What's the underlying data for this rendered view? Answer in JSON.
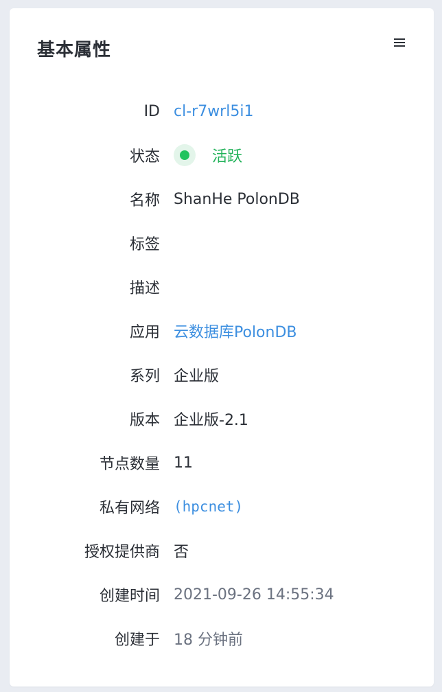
{
  "card": {
    "title": "基本属性",
    "menu_icon": "hamburger-menu-icon"
  },
  "properties": {
    "id": {
      "label": "ID",
      "value": "cl-r7wrl5i1"
    },
    "status": {
      "label": "状态",
      "value": "活跃",
      "color": "#21c35e"
    },
    "name": {
      "label": "名称",
      "value": "ShanHe PolonDB"
    },
    "tags": {
      "label": "标签",
      "value": ""
    },
    "description": {
      "label": "描述",
      "value": ""
    },
    "app": {
      "label": "应用",
      "value": "云数据库PolonDB"
    },
    "series": {
      "label": "系列",
      "value": "企业版"
    },
    "version": {
      "label": "版本",
      "value": "企业版-2.1"
    },
    "node_count": {
      "label": "节点数量",
      "value": "11"
    },
    "vpc": {
      "label": "私有网络",
      "value": "(hpcnet)"
    },
    "auth_provider": {
      "label": "授权提供商",
      "value": "否"
    },
    "create_time": {
      "label": "创建时间",
      "value": "2021-09-26 14:55:34"
    },
    "created_ago": {
      "label": "创建于",
      "value": "18 分钟前"
    }
  },
  "colors": {
    "link": "#3d8fe0",
    "status_green": "#21c35e",
    "text": "#2b2f36",
    "muted": "#6b7280"
  }
}
